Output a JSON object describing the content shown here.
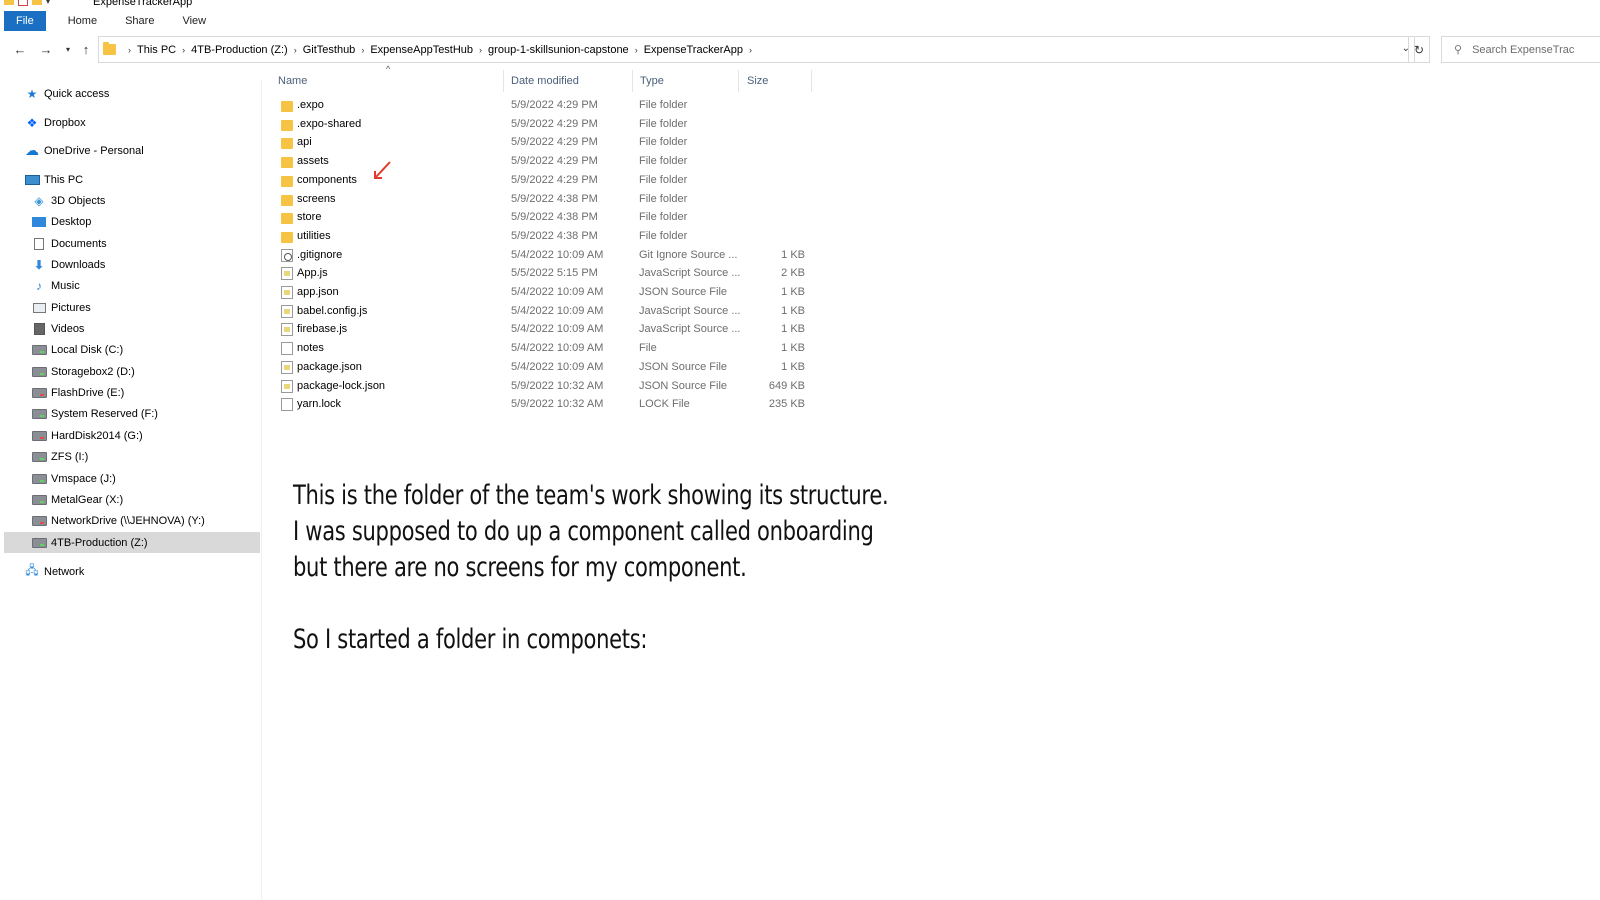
{
  "window": {
    "title": "ExpenseTrackerApp"
  },
  "ribbon": {
    "tabs": [
      "File",
      "Home",
      "Share",
      "View"
    ]
  },
  "address": {
    "crumbs": [
      "This PC",
      "4TB-Production (Z:)",
      "GitTesthub",
      "ExpenseAppTestHub",
      "group-1-skillsunion-capstone",
      "ExpenseTrackerApp"
    ],
    "search_placeholder": "Search ExpenseTrac"
  },
  "sidebar": {
    "items": [
      {
        "label": "Quick access",
        "icon": "star-icon"
      },
      {
        "label": "Dropbox",
        "icon": "dropbox-icon"
      },
      {
        "label": "OneDrive - Personal",
        "icon": "cloud-icon"
      },
      {
        "label": "This PC",
        "icon": "computer-icon"
      },
      {
        "label": "3D Objects",
        "icon": "cube-icon"
      },
      {
        "label": "Desktop",
        "icon": "desktop-icon"
      },
      {
        "label": "Documents",
        "icon": "document-icon"
      },
      {
        "label": "Downloads",
        "icon": "download-icon"
      },
      {
        "label": "Music",
        "icon": "music-icon"
      },
      {
        "label": "Pictures",
        "icon": "picture-icon"
      },
      {
        "label": "Videos",
        "icon": "video-icon"
      },
      {
        "label": "Local Disk (C:)",
        "icon": "drive-icon"
      },
      {
        "label": "Storagebox2 (D:)",
        "icon": "drive-icon"
      },
      {
        "label": "FlashDrive (E:)",
        "icon": "drive-icon"
      },
      {
        "label": "System Reserved (F:)",
        "icon": "drive-icon"
      },
      {
        "label": "HardDisk2014 (G:)",
        "icon": "drive-icon"
      },
      {
        "label": "ZFS (I:)",
        "icon": "drive-icon"
      },
      {
        "label": "Vmspace (J:)",
        "icon": "drive-icon"
      },
      {
        "label": "MetalGear (X:)",
        "icon": "drive-icon"
      },
      {
        "label": "NetworkDrive (\\\\JEHNOVA) (Y:)",
        "icon": "network-drive-icon"
      },
      {
        "label": "4TB-Production (Z:)",
        "icon": "drive-icon",
        "selected": true
      },
      {
        "label": "Network",
        "icon": "network-icon"
      }
    ]
  },
  "columns": {
    "name": "Name",
    "date": "Date modified",
    "type": "Type",
    "size": "Size"
  },
  "files": [
    {
      "name": ".expo",
      "date": "5/9/2022 4:29 PM",
      "type": "File folder",
      "size": "",
      "kind": "folder"
    },
    {
      "name": ".expo-shared",
      "date": "5/9/2022 4:29 PM",
      "type": "File folder",
      "size": "",
      "kind": "folder"
    },
    {
      "name": "api",
      "date": "5/9/2022 4:29 PM",
      "type": "File folder",
      "size": "",
      "kind": "folder"
    },
    {
      "name": "assets",
      "date": "5/9/2022 4:29 PM",
      "type": "File folder",
      "size": "",
      "kind": "folder"
    },
    {
      "name": "components",
      "date": "5/9/2022 4:29 PM",
      "type": "File folder",
      "size": "",
      "kind": "folder"
    },
    {
      "name": "screens",
      "date": "5/9/2022 4:38 PM",
      "type": "File folder",
      "size": "",
      "kind": "folder"
    },
    {
      "name": "store",
      "date": "5/9/2022 4:38 PM",
      "type": "File folder",
      "size": "",
      "kind": "folder"
    },
    {
      "name": "utilities",
      "date": "5/9/2022 4:38 PM",
      "type": "File folder",
      "size": "",
      "kind": "folder"
    },
    {
      "name": ".gitignore",
      "date": "5/4/2022 10:09 AM",
      "type": "Git Ignore Source ...",
      "size": "1 KB",
      "kind": "gear"
    },
    {
      "name": "App.js",
      "date": "5/5/2022 5:15 PM",
      "type": "JavaScript Source ...",
      "size": "2 KB",
      "kind": "js"
    },
    {
      "name": "app.json",
      "date": "5/4/2022 10:09 AM",
      "type": "JSON Source File",
      "size": "1 KB",
      "kind": "js"
    },
    {
      "name": "babel.config.js",
      "date": "5/4/2022 10:09 AM",
      "type": "JavaScript Source ...",
      "size": "1 KB",
      "kind": "js"
    },
    {
      "name": "firebase.js",
      "date": "5/4/2022 10:09 AM",
      "type": "JavaScript Source ...",
      "size": "1 KB",
      "kind": "js"
    },
    {
      "name": "notes",
      "date": "5/4/2022 10:09 AM",
      "type": "File",
      "size": "1 KB",
      "kind": "doc"
    },
    {
      "name": "package.json",
      "date": "5/4/2022 10:09 AM",
      "type": "JSON Source File",
      "size": "1 KB",
      "kind": "js"
    },
    {
      "name": "package-lock.json",
      "date": "5/9/2022 10:32 AM",
      "type": "JSON Source File",
      "size": "649 KB",
      "kind": "js"
    },
    {
      "name": "yarn.lock",
      "date": "5/9/2022 10:32 AM",
      "type": "LOCK File",
      "size": "235 KB",
      "kind": "doc"
    }
  ],
  "annotation": {
    "lines": [
      "This is the folder of the team's work showing its structure.",
      "I was supposed to do up a component called onboarding",
      "but there are no screens for my component.",
      "",
      "So I started a folder in componets:"
    ],
    "arrow_color": "#e23b2e"
  }
}
